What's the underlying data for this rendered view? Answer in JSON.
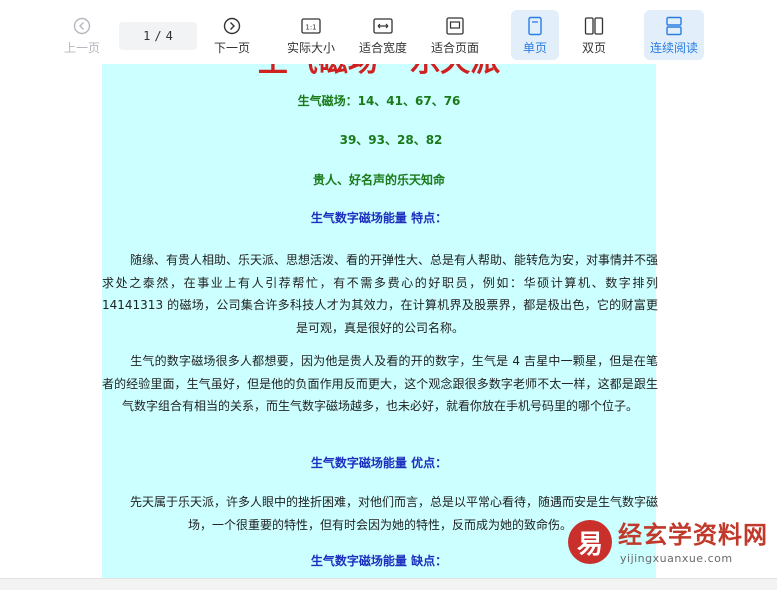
{
  "toolbar": {
    "prev_label": "上一页",
    "page_current": "1",
    "page_sep": "/",
    "page_total": "4",
    "next_label": "下一页",
    "actual_size_label": "实际大小",
    "actual_size_icon_text": "1:1",
    "fit_width_label": "适合宽度",
    "fit_page_label": "适合页面",
    "single_page_label": "单页",
    "double_page_label": "双页",
    "continuous_label": "连续阅读",
    "accent_color": "#2a7de1"
  },
  "document": {
    "title_partial": "生气磁场 · 乐天派",
    "line1": "生气磁场：14、41、67、76",
    "line2": "39、93、28、82",
    "subtitle": "贵人、好名声的乐天知命",
    "h_features": "生气数字磁场能量 特点：",
    "p1": "随缘、有贵人相助、乐天派、思想活泼、看的开弹性大、总是有人帮助、能转危为安，对事情并不强求处之泰然，在事业上有人引荐帮忙，有不需多费心的好职员，例如：华硕计算机、数字排列 14141313 的磁场，公司集合许多科技人才为其效力，在计算机界及股票界，都是极出色，它的财富更是可观，真是很好的公司名称。",
    "p2": "生气的数字磁场很多人都想要，因为他是贵人及看的开的数字，生气是 4 吉星中一颗星，但是在笔者的经验里面，生气虽好，但是他的负面作用反而更大，这个观念跟很多数字老师不太一样，这都是跟生气数字组合有相当的关系，而生气数字磁场越多，也未必好，就看你放在手机号码里的哪个位子。",
    "h_advantages": "生气数字磁场能量 优点：",
    "p3": "先天属于乐天派，许多人眼中的挫折困难，对他们而言，总是以平常心看待，随遇而安是生气数字磁场，一个很重要的特性，但有时会因为她的特性，反而成为她的致命伤。",
    "h_disadvantages": "生气数字磁场能量 缺点：",
    "page_bg": "#ccffff",
    "green_color": "#1a7a1a",
    "blue_color": "#1d2fbf"
  },
  "watermark": {
    "logo_char": "易",
    "name": "经玄学资料网",
    "url": "yijingxuanxue.com"
  }
}
